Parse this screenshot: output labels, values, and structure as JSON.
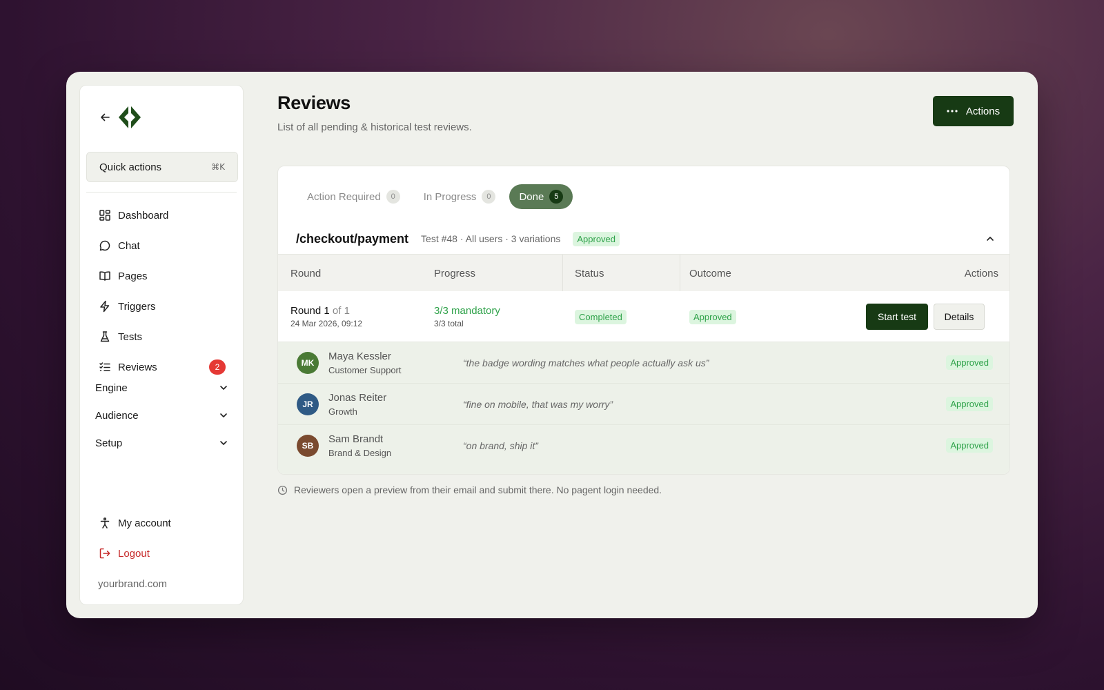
{
  "sidebar": {
    "quick_actions": {
      "label": "Quick actions",
      "shortcut": "⌘K"
    },
    "nav": [
      {
        "label": "Dashboard",
        "icon": "dashboard-icon"
      },
      {
        "label": "Chat",
        "icon": "chat-icon"
      },
      {
        "label": "Pages",
        "icon": "book-icon"
      },
      {
        "label": "Triggers",
        "icon": "lightning-icon"
      },
      {
        "label": "Tests",
        "icon": "flask-icon"
      },
      {
        "label": "Reviews",
        "icon": "checklist-icon",
        "badge": "2"
      }
    ],
    "groups": [
      {
        "label": "Engine"
      },
      {
        "label": "Audience"
      },
      {
        "label": "Setup"
      }
    ],
    "my_account": "My account",
    "logout": "Logout",
    "domain": "yourbrand.com"
  },
  "header": {
    "title": "Reviews",
    "subtitle": "List of all pending & historical test reviews.",
    "actions_label": "Actions"
  },
  "tabs": [
    {
      "label": "Action Required",
      "count": "0"
    },
    {
      "label": "In Progress",
      "count": "0"
    },
    {
      "label": "Done",
      "count": "5"
    }
  ],
  "test": {
    "route": "/checkout/payment",
    "meta": "Test #48 · All users · 3 variations",
    "status": "Approved"
  },
  "table": {
    "headers": {
      "round": "Round",
      "progress": "Progress",
      "status": "Status",
      "outcome": "Outcome",
      "actions": "Actions"
    },
    "row": {
      "round_label": "Round 1",
      "round_of": "of 1",
      "date": "24 Mar 2026, 09:12",
      "progress_main": "3/3 mandatory",
      "progress_sub": "3/3 total",
      "status": "Completed",
      "outcome": "Approved",
      "start_test": "Start test",
      "details": "Details"
    }
  },
  "reviewers": [
    {
      "initials": "MK",
      "name": "Maya Kessler",
      "role": "Customer Support",
      "quote": "“the badge wording matches what people actually ask us”",
      "verdict": "Approved",
      "color": "#4a7a35"
    },
    {
      "initials": "JR",
      "name": "Jonas Reiter",
      "role": "Growth",
      "quote": "“fine on mobile, that was my worry”",
      "verdict": "Approved",
      "color": "#2f5a85"
    },
    {
      "initials": "SB",
      "name": "Sam Brandt",
      "role": "Brand & Design",
      "quote": "“on brand, ship it”",
      "verdict": "Approved",
      "color": "#7a4a2f"
    }
  ],
  "footer_note": "Reviewers open a preview from their email and submit there. No pagent login needed.",
  "colors": {
    "brand_dark": "#173a14",
    "tab_active": "#5a7a55",
    "approved_text": "#2fa24a",
    "approved_bg": "#dcf5df",
    "danger": "#e53935"
  }
}
